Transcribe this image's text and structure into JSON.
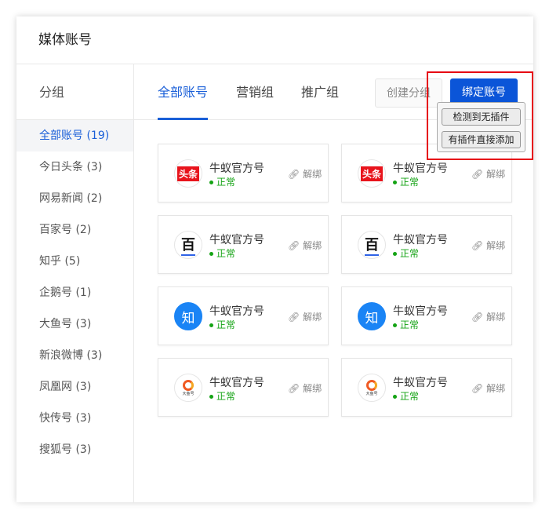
{
  "header": {
    "title": "媒体账号"
  },
  "sidebar": {
    "group_label": "分组",
    "items": [
      {
        "label": "全部账号 (19)"
      },
      {
        "label": "今日头条 (3)"
      },
      {
        "label": "网易新闻 (2)"
      },
      {
        "label": "百家号 (2)"
      },
      {
        "label": "知乎 (5)"
      },
      {
        "label": "企鹅号 (1)"
      },
      {
        "label": "大鱼号 (3)"
      },
      {
        "label": "新浪微博 (3)"
      },
      {
        "label": "凤凰网 (3)"
      },
      {
        "label": "快传号 (3)"
      },
      {
        "label": "搜狐号 (3)"
      }
    ]
  },
  "tabs": [
    {
      "label": "全部账号"
    },
    {
      "label": "营销组"
    },
    {
      "label": "推广组"
    }
  ],
  "toolbar": {
    "create_group": "创建分组",
    "bind_account": "绑定账号"
  },
  "dropdown": {
    "items": [
      {
        "label": "检测到无插件"
      },
      {
        "label": "有插件直接添加"
      }
    ]
  },
  "cards": [
    {
      "platform": "toutiao",
      "icon_text": "头条",
      "name": "牛蚁官方号",
      "status": "正常",
      "unbind": "解绑"
    },
    {
      "platform": "toutiao",
      "icon_text": "头条",
      "name": "牛蚁官方号",
      "status": "正常",
      "unbind": "解绑"
    },
    {
      "platform": "baijia",
      "icon_text": "百",
      "name": "牛蚁官方号",
      "status": "正常",
      "unbind": "解绑"
    },
    {
      "platform": "baijia",
      "icon_text": "百",
      "name": "牛蚁官方号",
      "status": "正常",
      "unbind": "解绑"
    },
    {
      "platform": "zhihu",
      "icon_text": "知",
      "name": "牛蚁官方号",
      "status": "正常",
      "unbind": "解绑"
    },
    {
      "platform": "zhihu",
      "icon_text": "知",
      "name": "牛蚁官方号",
      "status": "正常",
      "unbind": "解绑"
    },
    {
      "platform": "dayu",
      "icon_text": "大鱼号",
      "name": "牛蚁官方号",
      "status": "正常",
      "unbind": "解绑"
    },
    {
      "platform": "dayu",
      "icon_text": "大鱼号",
      "name": "牛蚁官方号",
      "status": "正常",
      "unbind": "解绑"
    }
  ],
  "colors": {
    "accent": "#0b55d8",
    "status": "#14a314",
    "highlight": "#e60012"
  }
}
